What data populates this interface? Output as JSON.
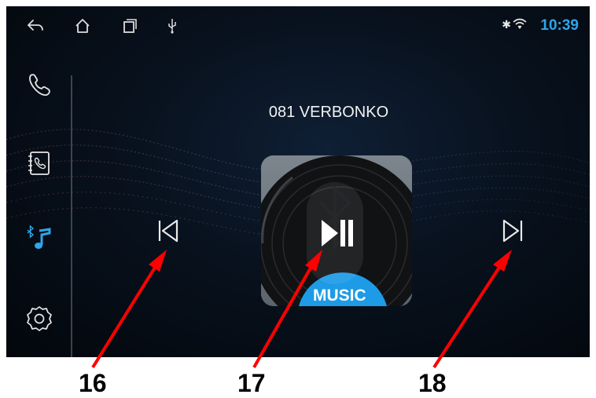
{
  "status_bar": {
    "icons": [
      "back-icon",
      "home-icon",
      "recent-apps-icon",
      "usb-icon"
    ],
    "bluetooth_glyph": "✱",
    "time": "10:39"
  },
  "sidebar": {
    "items": [
      {
        "name": "phone-icon"
      },
      {
        "name": "contacts-book-icon"
      },
      {
        "name": "bluetooth-music-icon",
        "active": true
      },
      {
        "name": "settings-gear-icon"
      }
    ]
  },
  "player": {
    "track_title": "081 VERBONKO",
    "album_label": "MUSIC",
    "controls": [
      "previous-track",
      "play-pause",
      "next-track"
    ]
  },
  "callouts": [
    "16",
    "17",
    "18"
  ],
  "colors": {
    "accent": "#2ea6ea",
    "arrow": "#ff0000",
    "background": "#08111d"
  }
}
